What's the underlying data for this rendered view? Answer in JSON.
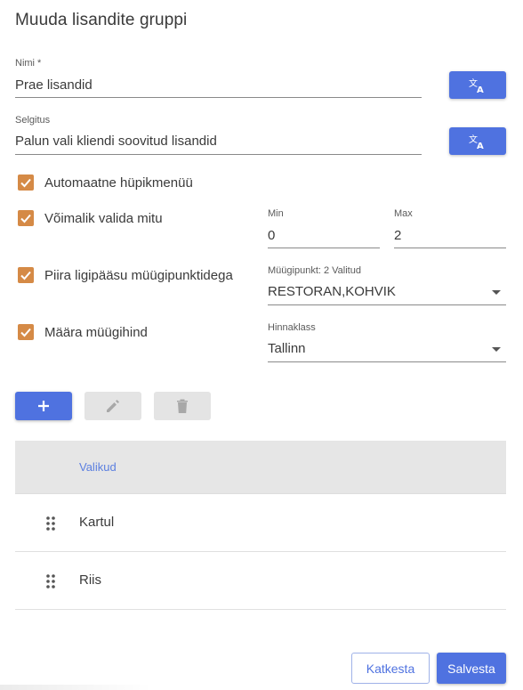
{
  "dialog": {
    "title": "Muuda lisandite gruppi"
  },
  "name_field": {
    "label": "Nimi *",
    "value": "Prae lisandid"
  },
  "description_field": {
    "label": "Selgitus",
    "value": "Palun vali kliendi soovitud lisandid"
  },
  "translate_icon": "translate-icon",
  "options": {
    "auto_popup": {
      "label": "Automaatne hüpikmenüü",
      "checked": true
    },
    "multi_select": {
      "label": "Võimalik valida mitu",
      "checked": true
    },
    "restrict_pos": {
      "label": "Piira ligipääsu müügipunktidega",
      "checked": true
    },
    "set_price": {
      "label": "Määra müügihind",
      "checked": true
    }
  },
  "min_field": {
    "label": "Min",
    "value": "0"
  },
  "max_field": {
    "label": "Max",
    "value": "2"
  },
  "pos_select": {
    "label": "Müügipunkt: 2 Valitud",
    "value": "RESTORAN,KOHVIK"
  },
  "price_class_select": {
    "label": "Hinnaklass",
    "value": "Tallinn"
  },
  "toolbar": {
    "add_icon": "plus-icon",
    "edit_icon": "pencil-icon",
    "delete_icon": "trash-icon"
  },
  "table": {
    "header": "Valikud",
    "rows": [
      {
        "label": "Kartul"
      },
      {
        "label": "Riis"
      }
    ]
  },
  "footer": {
    "cancel_label": "Katkesta",
    "save_label": "Salvesta"
  },
  "colors": {
    "primary": "#4f72e0",
    "checkbox": "#d58a46",
    "header_bg": "#e6e6e6"
  }
}
